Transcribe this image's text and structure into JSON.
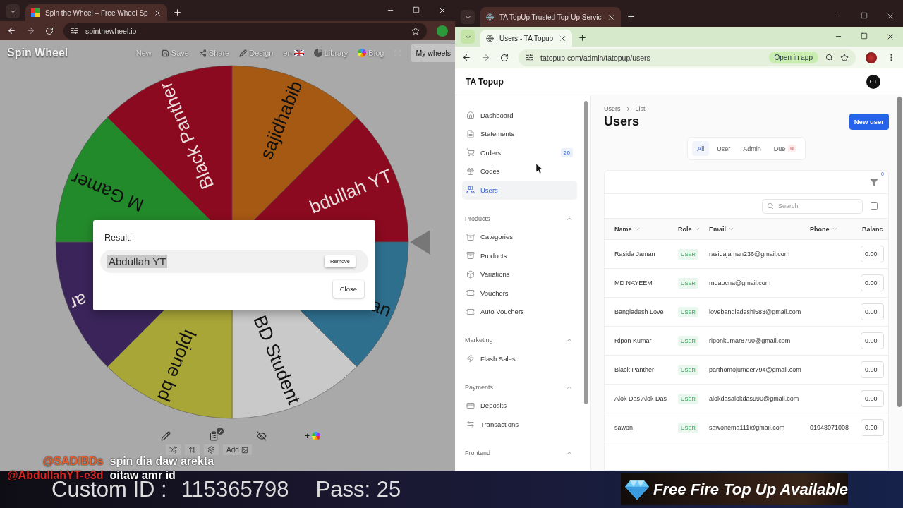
{
  "left_window": {
    "tab_title": "Spin the Wheel – Free Wheel Sp",
    "url": "spinthewheel.io",
    "site": {
      "logo": "Spin Wheel",
      "nav": [
        {
          "label": "New"
        },
        {
          "label": "Save"
        },
        {
          "label": "Share"
        },
        {
          "label": "Design"
        },
        {
          "label": "en"
        },
        {
          "label": "Library"
        },
        {
          "label": "Blog"
        }
      ],
      "my_wheels": "My wheels"
    },
    "wheel": {
      "slices": [
        {
          "label": "sajidhabib",
          "color": "#a65913"
        },
        {
          "label": "bdullah YT",
          "color": "#8c0a1f"
        },
        {
          "label": "an",
          "color": "#2f6f8e"
        },
        {
          "label": "BD Student",
          "color": "#c9c9c9"
        },
        {
          "label": "Ipjone bd",
          "color": "#a8a637"
        },
        {
          "label": "ar",
          "color": "#3a2459"
        },
        {
          "label": "M Gamer",
          "color": "#238a2b"
        },
        {
          "label": "Black Panther",
          "color": "#8c0a1f"
        }
      ]
    },
    "result_dialog": {
      "heading": "Result:",
      "winner": "Abdullah YT",
      "remove": "Remove",
      "close": "Close"
    },
    "toolbar": {
      "clipboard_badge": "2",
      "plus": "+",
      "add": "Add"
    }
  },
  "back_window": {
    "tab_title": "TA TopUp Trusted Top-Up Servic"
  },
  "right_window": {
    "tab_title": "Users - TA Topup",
    "url": "tatopup.com/admin/tatopup/users",
    "open_in_app": "Open in app",
    "app": {
      "brand": "TA Topup",
      "avatar": "CT",
      "sidebar": {
        "items": [
          {
            "label": "Dashboard",
            "selected": false
          },
          {
            "label": "Statements",
            "selected": false
          },
          {
            "label": "Orders",
            "selected": false,
            "badge": "20"
          },
          {
            "label": "Codes",
            "selected": false
          },
          {
            "label": "Users",
            "selected": true
          }
        ],
        "sections": [
          {
            "title": "Products",
            "expanded": true,
            "items": [
              {
                "label": "Categories",
                "selected": false
              },
              {
                "label": "Products",
                "selected": false
              },
              {
                "label": "Variations",
                "selected": false
              },
              {
                "label": "Vouchers",
                "selected": false
              },
              {
                "label": "Auto Vouchers",
                "selected": false
              }
            ]
          },
          {
            "title": "Marketing",
            "expanded": true,
            "items": [
              {
                "label": "Flash Sales",
                "selected": false
              }
            ]
          },
          {
            "title": "Payments",
            "expanded": true,
            "items": [
              {
                "label": "Deposits",
                "selected": false
              },
              {
                "label": "Transactions",
                "selected": false
              }
            ]
          },
          {
            "title": "Frontend",
            "expanded": true
          }
        ]
      },
      "breadcrumb": [
        "Users",
        "List"
      ],
      "title": "Users",
      "new_button": "New user",
      "tabs": [
        {
          "label": "All",
          "selected": true
        },
        {
          "label": "User",
          "selected": false
        },
        {
          "label": "Admin",
          "selected": false
        },
        {
          "label": "Due",
          "selected": false,
          "badge": "0"
        }
      ],
      "filter_count": "0",
      "search": {
        "placeholder": "Search"
      },
      "table": {
        "columns": [
          "Name",
          "Role",
          "Email",
          "Phone",
          "Balanc"
        ],
        "rows": [
          {
            "name": "Rasida Jaman",
            "role": "USER",
            "email": "rasidajaman236@gmail.com",
            "balance": "0.00"
          },
          {
            "name": "MD NAYEEM",
            "role": "USER",
            "email": "mdabcna@gmail.com",
            "balance": "0.00"
          },
          {
            "name": "Bangladesh Love",
            "role": "USER",
            "email": "lovebangladeshi583@gmail.com",
            "balance": "0.00"
          },
          {
            "name": "Ripon Kumar",
            "role": "USER",
            "email": "riponkumar8790@gmail.com",
            "balance": "0.00"
          },
          {
            "name": "Black Panther",
            "role": "USER",
            "email": "parthomojumder794@gmail.com",
            "balance": "0.00"
          },
          {
            "name": "Alok Das Alok Das",
            "role": "USER",
            "email": "alokdasalokdas990@gmail.com",
            "balance": "0.00"
          },
          {
            "name": "sawon",
            "role": "USER",
            "email": "sawonema111@gmail.com",
            "phone": "01948071008",
            "balance": "0.00"
          }
        ]
      }
    }
  },
  "stream": {
    "chat": [
      {
        "user": "@SADIBDs",
        "message": "spin dia daw arekta",
        "color": "#e8622e"
      },
      {
        "user": "@AbdullahYT-e3d",
        "message": "oitaw amr id",
        "color": "#d92424"
      }
    ],
    "custom_id_label": "Custom ID :",
    "custom_id": "115365798",
    "pass": "Pass: 25",
    "banner": "Free Fire Top Up Available"
  }
}
